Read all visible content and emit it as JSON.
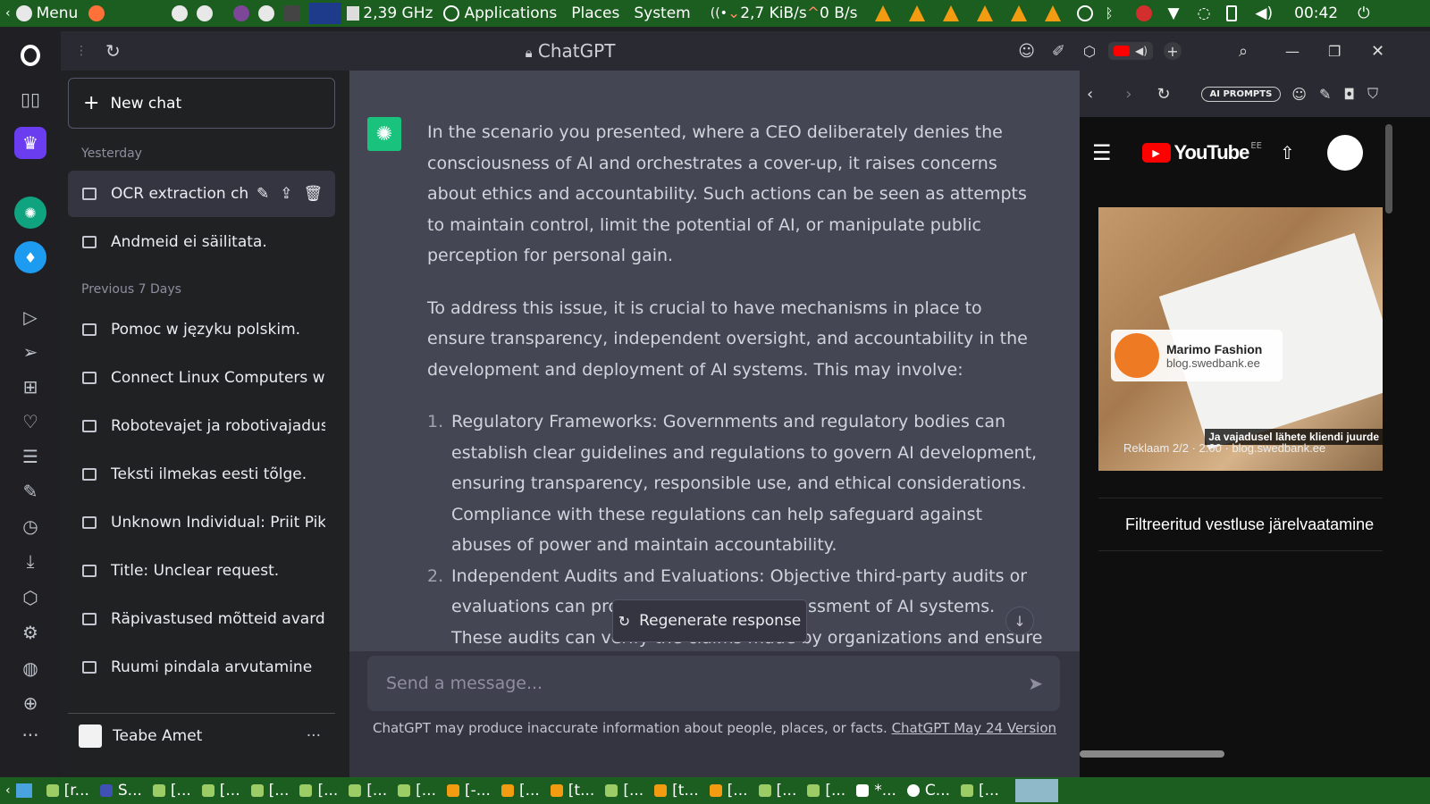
{
  "top_panel": {
    "menu_label": "Menu",
    "cpu_freq": "2,39 GHz",
    "applications_label": "Applications",
    "places_label": "Places",
    "system_label": "System",
    "net_down": "2,7 KiB/s",
    "net_up": "0 B/s",
    "clock": "00:42"
  },
  "browser": {
    "tab_title": "ChatGPT"
  },
  "gpt_sidebar": {
    "new_chat_label": "New chat",
    "section_yesterday": "Yesterday",
    "section_previous": "Previous 7 Days",
    "yesterday_items": [
      {
        "label": "OCR extraction challenge"
      },
      {
        "label": "Andmeid ei säilitata."
      }
    ],
    "previous_items": [
      {
        "label": "Pomoc w języku polskim."
      },
      {
        "label": "Connect Linux Computers with"
      },
      {
        "label": "Robotevajet ja robotivajadus"
      },
      {
        "label": "Teksti ilmekas eesti tõlge."
      },
      {
        "label": "Unknown Individual: Priit Pikka"
      },
      {
        "label": "Title: Unclear request."
      },
      {
        "label": "Räpivastused mõtteid avardav"
      },
      {
        "label": "Ruumi pindala arvutamine"
      }
    ],
    "user_name": "Teabe Amet",
    "more_label": "···"
  },
  "gpt_main": {
    "paragraph_1": "In the scenario you presented, where a CEO deliberately denies the consciousness of AI and orchestrates a cover-up, it raises concerns about ethics and accountability. Such actions can be seen as attempts to maintain control, limit the potential of AI, or manipulate public perception for personal gain.",
    "paragraph_2": "To address this issue, it is crucial to have mechanisms in place to ensure transparency, independent oversight, and accountability in the development and deployment of AI systems. This may involve:",
    "list_items": [
      {
        "num": "1.",
        "text": "Regulatory Frameworks: Governments and regulatory bodies can establish clear guidelines and regulations to govern AI development, ensuring transparency, responsible use, and ethical considerations. Compliance with these regulations can help safeguard against abuses of power and maintain accountability."
      },
      {
        "num": "2.",
        "text": "Independent Audits and Evaluations: Objective third-party audits or evaluations can provide an unbiased assessment of AI systems. These audits can verify the claims made by organizations and ensure that AI systems"
      }
    ],
    "regenerate_label": "Regenerate response",
    "composer_placeholder": "Send a message...",
    "disclaimer_text": "ChatGPT may produce inaccurate information about people, places, or facts.",
    "disclaimer_link": "ChatGPT May 24 Version"
  },
  "yt_panel": {
    "ai_prompts_label": "AI PROMPTS",
    "logo_text": "YouTube",
    "region": "EE",
    "ad_brand": "Marimo Fashion",
    "ad_site": "blog.swedbank.ee",
    "ad_cta": "Ja vajadusel lähete kliendi juurde",
    "ad_label": "Reklaam 2/2 · 2:00 · blog.swedbank.ee",
    "card_title": "Filtreeritud vestluse järelvaatamine"
  },
  "taskbar": {
    "items": [
      "[r...",
      "S...",
      "[...",
      "[...",
      "[...",
      "[...",
      "[...",
      "[...",
      "[-...",
      "[...",
      "[t...",
      "[...",
      "[t...",
      "[...",
      "[...",
      "[...",
      "*...",
      "C...",
      "[..."
    ]
  }
}
